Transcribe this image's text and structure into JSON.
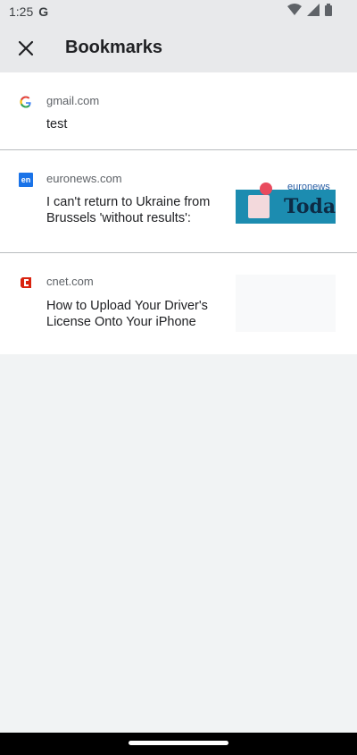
{
  "status_bar": {
    "time": "1:25",
    "g_label": "G"
  },
  "app_bar": {
    "title": "Bookmarks",
    "close_icon": "close-icon"
  },
  "bookmarks": [
    {
      "domain": "gmail.com",
      "title": "test",
      "favicon": "google-icon",
      "has_thumbnail": false
    },
    {
      "domain": "euronews.com",
      "title": "I can't return to Ukraine from Brussels 'without results':",
      "favicon": "euronews-icon",
      "has_thumbnail": true,
      "thumbnail": {
        "brand_text": "euronews",
        "big_text": "Toda"
      }
    },
    {
      "domain": "cnet.com",
      "title": "How to Upload Your Driver's License Onto Your iPhone",
      "favicon": "cnet-icon",
      "has_thumbnail": true
    },
    {
      "favicon_text": "en"
    }
  ],
  "colors": {
    "background": "#f1f3f4",
    "appbar": "#e8e9eb",
    "euronews_blue": "#1a73e8",
    "cnet_red": "#d9230f"
  }
}
